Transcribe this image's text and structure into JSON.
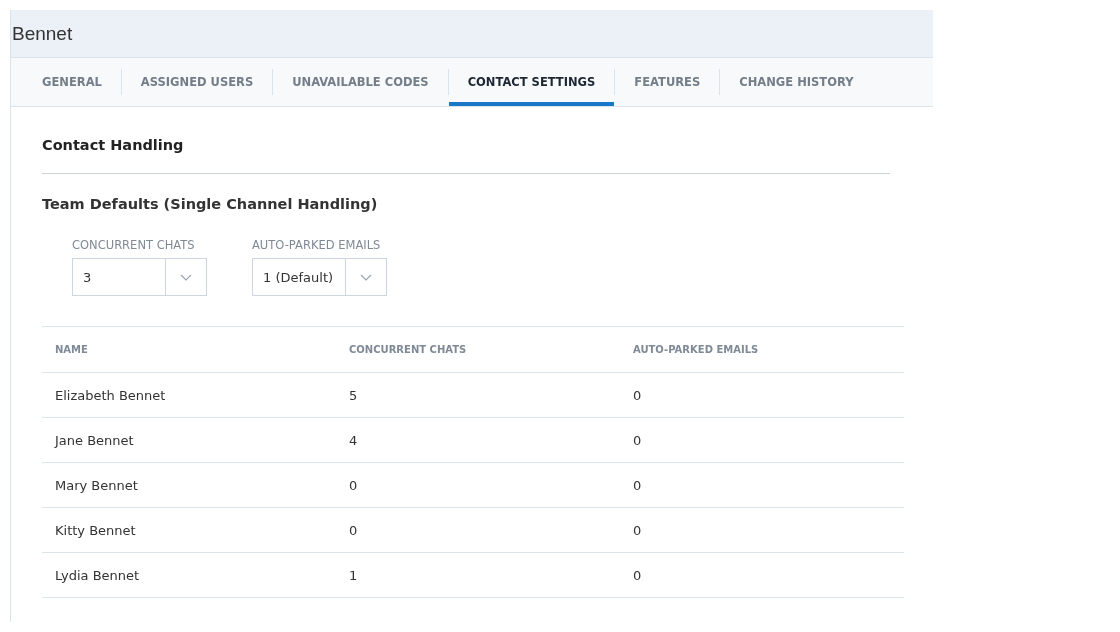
{
  "header": {
    "title": "Bennet"
  },
  "tabs": [
    {
      "label": "GENERAL",
      "selected": false
    },
    {
      "label": "ASSIGNED USERS",
      "selected": false
    },
    {
      "label": "UNAVAILABLE CODES",
      "selected": false
    },
    {
      "label": "CONTACT SETTINGS",
      "selected": true
    },
    {
      "label": "FEATURES",
      "selected": false
    },
    {
      "label": "CHANGE HISTORY",
      "selected": false
    }
  ],
  "section_title": "Contact Handling",
  "subsection_title": "Team Defaults (Single Channel Handling)",
  "dropdowns": [
    {
      "label": "CONCURRENT CHATS",
      "value": "3"
    },
    {
      "label": "AUTO-PARKED EMAILS",
      "value": "1 (Default)"
    }
  ],
  "table": {
    "columns": [
      "NAME",
      "CONCURRENT CHATS",
      "AUTO-PARKED EMAILS"
    ],
    "rows": [
      [
        "Elizabeth Bennet",
        "5",
        "0"
      ],
      [
        "Jane Bennet",
        "4",
        "0"
      ],
      [
        "Mary Bennet",
        "0",
        "0"
      ],
      [
        "Kitty Bennet",
        "0",
        "0"
      ],
      [
        "Lydia Bennet",
        "1",
        "0"
      ]
    ]
  }
}
